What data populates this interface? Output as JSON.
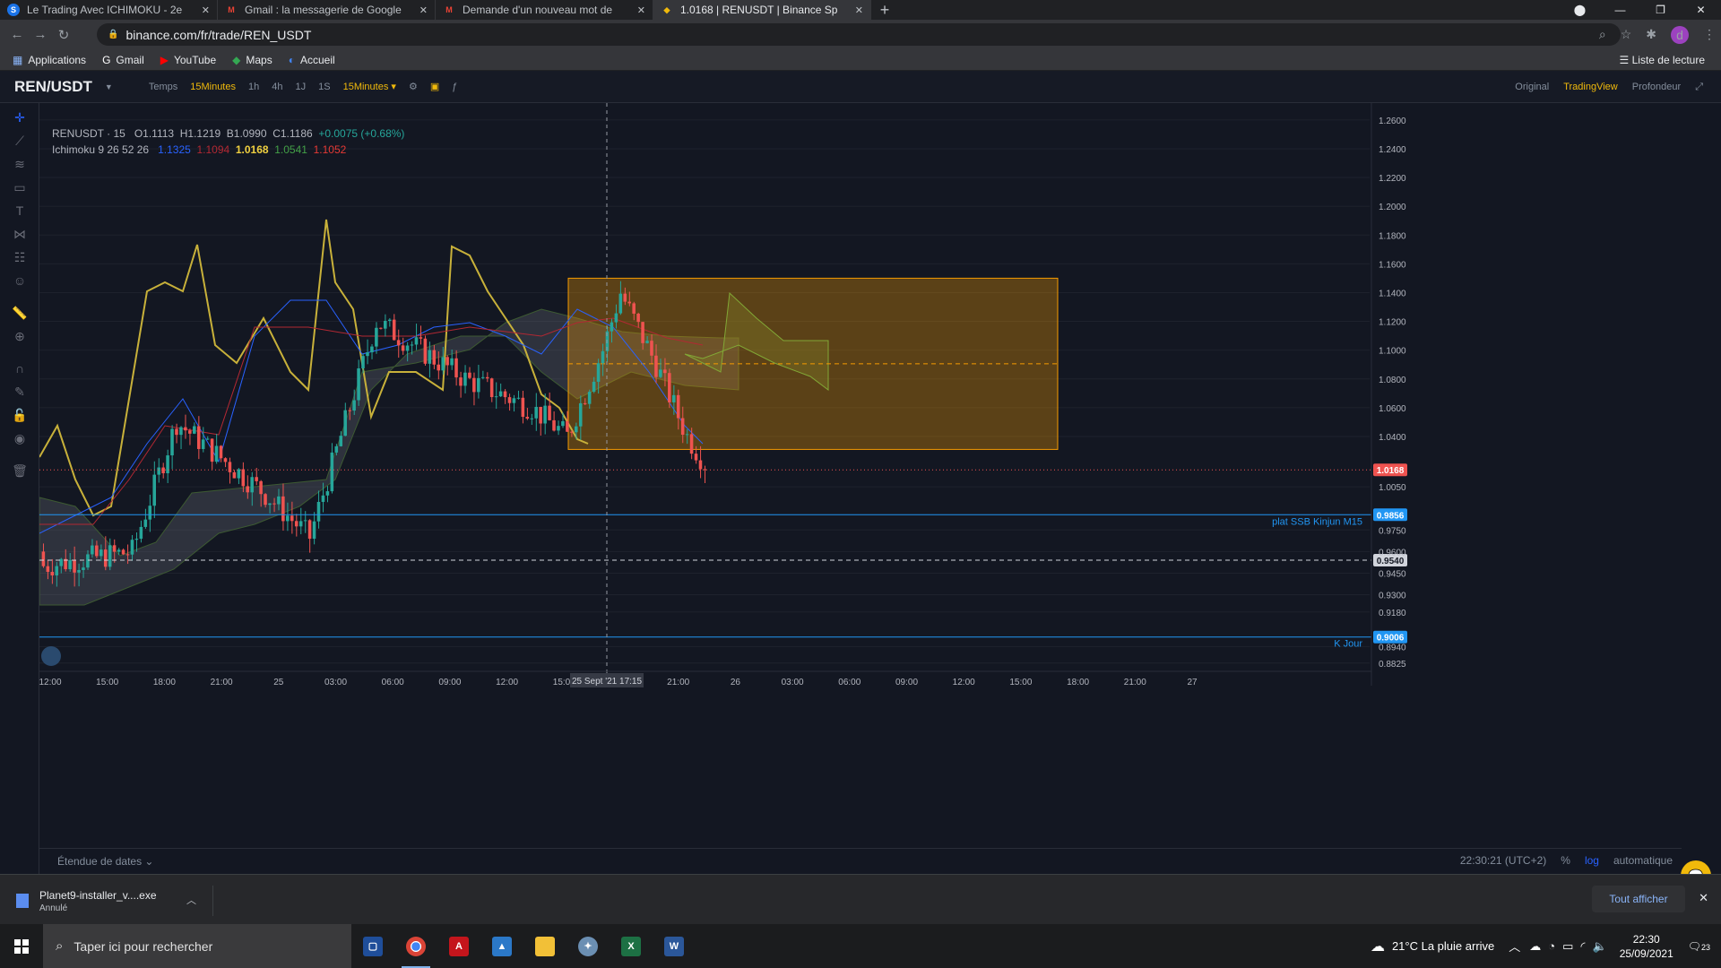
{
  "browser": {
    "tabs": [
      {
        "title": "Le Trading Avec ICHIMOKU - 2e",
        "icon": "S",
        "icon_color": "#1a73e8"
      },
      {
        "title": "Gmail : la messagerie de Google",
        "icon": "M",
        "icon_color": "#ea4335"
      },
      {
        "title": "Demande d'un nouveau mot de",
        "icon": "M",
        "icon_color": "#ea4335"
      },
      {
        "title": "1.0168 | RENUSDT | Binance Sp",
        "icon": "◆",
        "icon_color": "#f0b90b"
      }
    ],
    "url": "binance.com/fr/trade/REN_USDT",
    "bookmarks": [
      {
        "label": "Applications",
        "icon": "apps-icon"
      },
      {
        "label": "Gmail",
        "icon": "gmail-icon"
      },
      {
        "label": "YouTube",
        "icon": "youtube-icon"
      },
      {
        "label": "Maps",
        "icon": "maps-icon"
      },
      {
        "label": "Accueil",
        "icon": "home-icon"
      }
    ],
    "reading_list": "Liste de lecture",
    "avatar": "d"
  },
  "tv": {
    "pair": "REN/USDT",
    "timeframes": [
      {
        "label": "Temps",
        "on": false
      },
      {
        "label": "15Minutes",
        "on": true
      },
      {
        "label": "1h",
        "on": false
      },
      {
        "label": "4h",
        "on": false
      },
      {
        "label": "1J",
        "on": false
      },
      {
        "label": "1S",
        "on": false
      },
      {
        "label": "15Minutes ▾",
        "on": true
      }
    ],
    "views": [
      {
        "label": "Original",
        "on": false
      },
      {
        "label": "TradingView",
        "on": true
      },
      {
        "label": "Profondeur",
        "on": false
      }
    ]
  },
  "legend": {
    "symbol": "RENUSDT · 15",
    "open": "O1.1113",
    "high": "H1.1219",
    "low": "B1.0990",
    "close": "C1.1186",
    "change": "+0.0075 (+0.68%)",
    "ichimoku_label": "Ichimoku 9 26 52 26",
    "ichimoku_values": [
      {
        "v": "1.1325",
        "color": "#2962ff"
      },
      {
        "v": "1.1094",
        "color": "#b22833"
      },
      {
        "v": "1.0168",
        "color": "#f0d040"
      },
      {
        "v": "1.0541",
        "color": "#43a047"
      },
      {
        "v": "1.1052",
        "color": "#e53935"
      }
    ]
  },
  "price_axis": {
    "ticks": [
      "1.2600",
      "1.2400",
      "1.2200",
      "1.2000",
      "1.1800",
      "1.1600",
      "1.1400",
      "1.1200",
      "1.1000",
      "1.0800",
      "1.0600",
      "1.0400",
      "1.0050",
      "0.9750",
      "0.9600",
      "0.9450",
      "0.9300",
      "0.9180",
      "0.8940",
      "0.8825"
    ],
    "tick_values": [
      1.26,
      1.24,
      1.22,
      1.2,
      1.18,
      1.16,
      1.14,
      1.12,
      1.1,
      1.08,
      1.06,
      1.04,
      1.005,
      0.975,
      0.96,
      0.945,
      0.93,
      0.918,
      0.894,
      0.8825
    ],
    "last_price": "1.0168",
    "levels": [
      {
        "value": "0.9856",
        "label": "plat SSB Kinjun M15",
        "color": "#2196f3"
      },
      {
        "value": "0.9540",
        "label": "",
        "color": "#d1d4dc"
      },
      {
        "value": "0.9006",
        "label": "K Jour",
        "color": "#2196f3"
      }
    ]
  },
  "time_axis": {
    "ticks": [
      "12:00",
      "15:00",
      "18:00",
      "21:00",
      "25",
      "03:00",
      "06:00",
      "09:00",
      "12:00",
      "15:00",
      "18:00",
      "21:00",
      "26",
      "03:00",
      "06:00",
      "09:00",
      "12:00",
      "15:00",
      "18:00",
      "21:00",
      "27"
    ],
    "crosshair_label": "25 Sept '21   17:15"
  },
  "box": {
    "top": 1.15,
    "bottom": 1.031,
    "mid": 1.0905,
    "color": "#f59b00"
  },
  "bottom_bar": {
    "range_label": "Étendue de dates ⌄",
    "time": "22:30:21 (UTC+2)",
    "pct": "%",
    "log": "log",
    "auto": "automatique"
  },
  "download": {
    "name": "Planet9-installer_v....exe",
    "status": "Annulé",
    "show_all": "Tout afficher"
  },
  "taskbar": {
    "search_placeholder": "Taper ici pour rechercher",
    "weather": "21°C  La pluie arrive",
    "time": "22:30",
    "date": "25/09/2021",
    "notif_count": "23"
  },
  "colors": {
    "up": "#26a69a",
    "down": "#ef5350",
    "tenkan": "#2962ff",
    "kijun": "#b22833",
    "chikou": "#c8b13a"
  }
}
